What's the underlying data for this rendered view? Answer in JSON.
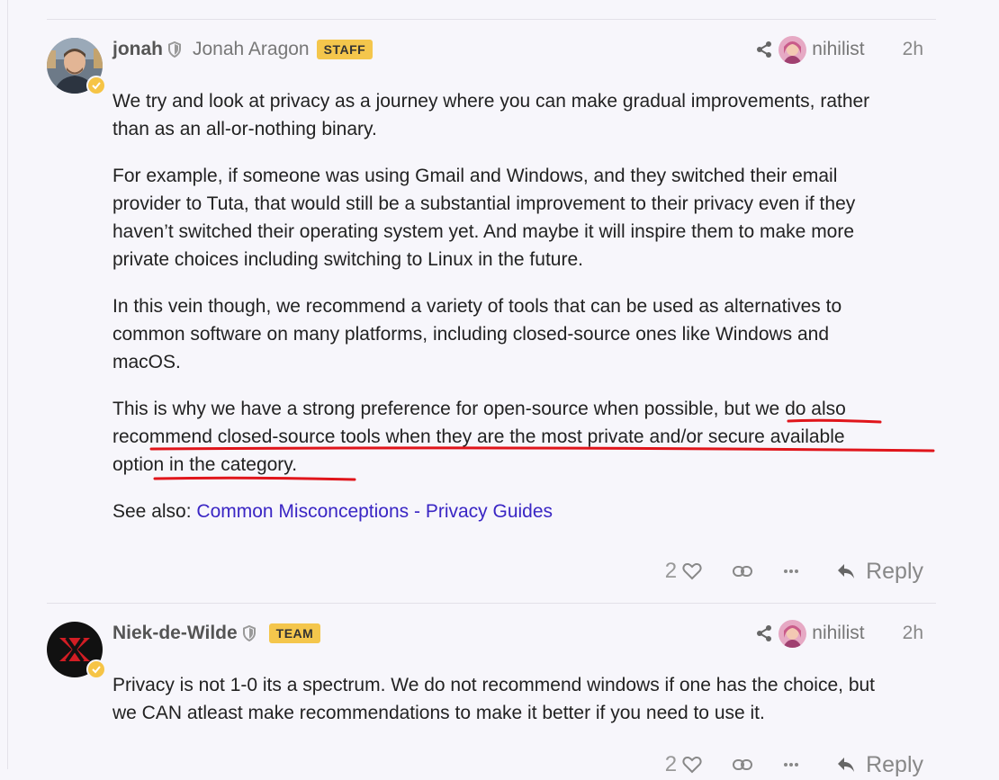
{
  "posts": [
    {
      "username": "jonah",
      "full_name": "Jonah Aragon",
      "badge": "STAFF",
      "reply_to_user": "nihilist",
      "time": "2h",
      "paragraphs": [
        "We try and look at privacy as a journey where you can make gradual improvements, rather than as an all-or-nothing binary.",
        "For example, if someone was using Gmail and Windows, and they switched their email provider to Tuta, that would still be a substantial improvement to their privacy even if they haven’t switched their operating system yet. And maybe it will inspire them to make more private choices including switching to Linux in the future.",
        "In this vein though, we recommend a variety of tools that can be used as alternatives to common software on many platforms, including closed-source ones like Windows and macOS."
      ],
      "highlight_para_start": "This is why we have a strong preference for open-source when possible,",
      "highlight_text": " but we do also recommend closed-source tools when they are the most private and/or secure available option in the category.",
      "see_also_label": "See also: ",
      "see_also_link": "Common Misconceptions - Privacy Guides",
      "like_count": "2",
      "reply_label": "Reply"
    },
    {
      "username": "Niek-de-Wilde",
      "badge": "TEAM",
      "reply_to_user": "nihilist",
      "time": "2h",
      "paragraphs": [
        "Privacy is not 1-0 its a spectrum. We do not recommend windows if one has the choice, but we CAN atleast make recommendations to make it better if you need to use it."
      ],
      "like_count": "2",
      "reply_label": "Reply"
    }
  ],
  "colors": {
    "badge": "#f4c64c",
    "link": "#3a26c4",
    "annotation": "#e0151b",
    "background": "#f7f6fb"
  }
}
